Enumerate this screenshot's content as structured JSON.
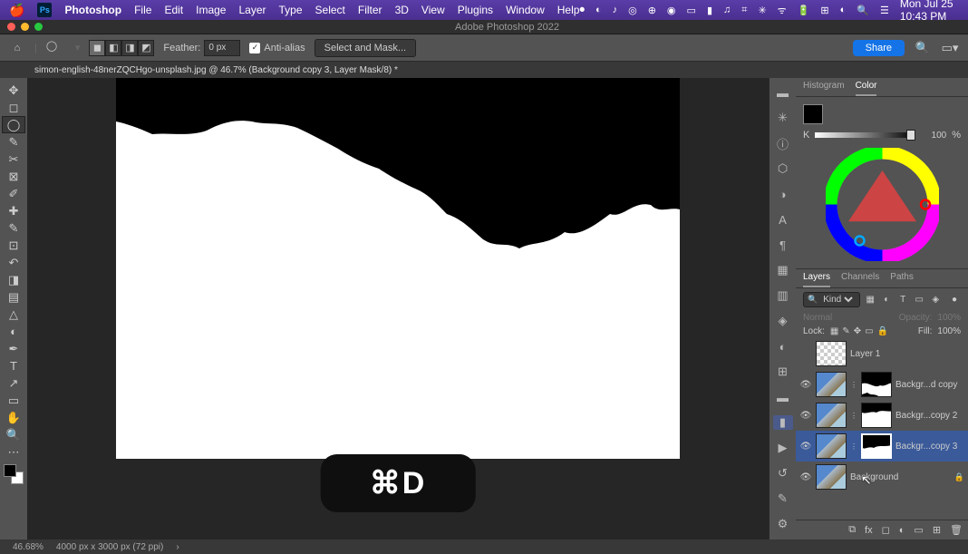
{
  "menubar": {
    "app": "Photoshop",
    "items": [
      "File",
      "Edit",
      "Image",
      "Layer",
      "Type",
      "Select",
      "Filter",
      "3D",
      "View",
      "Plugins",
      "Window",
      "Help"
    ],
    "datetime": "Mon Jul 25  10:43 PM"
  },
  "window": {
    "title": "Adobe Photoshop 2022"
  },
  "options": {
    "feather_label": "Feather:",
    "feather_value": "0 px",
    "antialias_label": "Anti-alias",
    "select_mask": "Select and Mask...",
    "share": "Share"
  },
  "doc_tab": "simon-english-48nerZQCHgo-unsplash.jpg @ 46.7% (Background copy 3, Layer Mask/8) *",
  "color_panel": {
    "tabs": [
      "Histogram",
      "Color"
    ],
    "k_value": "100",
    "pct": "%",
    "k_label": "K"
  },
  "layers_panel": {
    "tabs": [
      "Layers",
      "Channels",
      "Paths"
    ],
    "kind": "Kind",
    "blend": "Normal",
    "opacity_label": "Opacity:",
    "opacity_val": "100%",
    "lock_label": "Lock:",
    "fill_label": "Fill:",
    "fill_val": "100%",
    "layers": [
      {
        "name": "Layer 1",
        "vis": false,
        "mask": null,
        "empty": true
      },
      {
        "name": "Backgr...d copy",
        "vis": true,
        "mask": "m1"
      },
      {
        "name": "Backgr...copy 2",
        "vis": true,
        "mask": "m2"
      },
      {
        "name": "Backgr...copy 3",
        "vis": true,
        "mask": "m3",
        "selected": true
      },
      {
        "name": "Background",
        "vis": true,
        "mask": null,
        "locked": true
      }
    ]
  },
  "kbd": "⌘D",
  "status": {
    "zoom": "46.68%",
    "dims": "4000 px x 3000 px (72 ppi)"
  }
}
